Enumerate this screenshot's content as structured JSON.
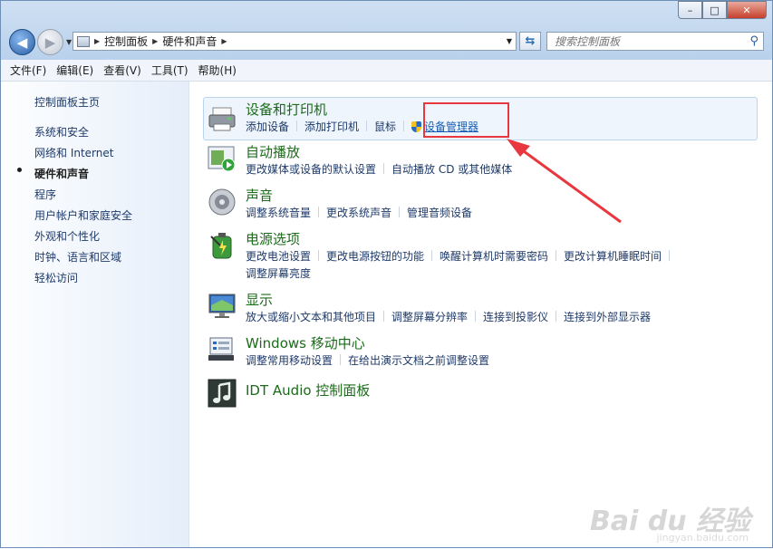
{
  "window": {
    "caption": {
      "minimize": "–",
      "maximize": "□",
      "close": "✕"
    }
  },
  "address": {
    "crumbs": [
      "控制面板",
      "硬件和声音"
    ],
    "search_placeholder": "搜索控制面板"
  },
  "menu": [
    "文件(F)",
    "编辑(E)",
    "查看(V)",
    "工具(T)",
    "帮助(H)"
  ],
  "sidebar": {
    "items": [
      {
        "label": "控制面板主页"
      },
      {
        "label": "系统和安全"
      },
      {
        "label": "网络和 Internet"
      },
      {
        "label": "硬件和声音",
        "current": true
      },
      {
        "label": "程序"
      },
      {
        "label": "用户帐户和家庭安全"
      },
      {
        "label": "外观和个性化"
      },
      {
        "label": "时钟、语言和区域"
      },
      {
        "label": "轻松访问"
      }
    ]
  },
  "categories": [
    {
      "title": "设备和打印机",
      "links": [
        "添加设备",
        "添加打印机",
        "鼠标",
        "设备管理器"
      ],
      "icon": "printer-icon"
    },
    {
      "title": "自动播放",
      "links": [
        "更改媒体或设备的默认设置",
        "自动播放 CD 或其他媒体"
      ],
      "icon": "autoplay-icon"
    },
    {
      "title": "声音",
      "links": [
        "调整系统音量",
        "更改系统声音",
        "管理音频设备"
      ],
      "icon": "speaker-icon"
    },
    {
      "title": "电源选项",
      "links": [
        "更改电池设置",
        "更改电源按钮的功能",
        "唤醒计算机时需要密码",
        "更改计算机睡眠时间"
      ],
      "links2": [
        "调整屏幕亮度"
      ],
      "icon": "battery-icon"
    },
    {
      "title": "显示",
      "links": [
        "放大或缩小文本和其他项目",
        "调整屏幕分辨率",
        "连接到投影仪",
        "连接到外部显示器"
      ],
      "icon": "monitor-icon"
    },
    {
      "title": "Windows 移动中心",
      "links": [
        "调整常用移动设置",
        "在给出演示文档之前调整设置"
      ],
      "icon": "mobility-center-icon"
    },
    {
      "title": "IDT Audio 控制面板",
      "links": [],
      "icon": "music-note-icon"
    }
  ],
  "watermark": {
    "brand": "Bai du 经验",
    "url": "jingyan.baidu.com"
  },
  "colors": {
    "link": "#1e3a6a",
    "category_title": "#1c6b1a",
    "highlight": "#e8373e"
  }
}
